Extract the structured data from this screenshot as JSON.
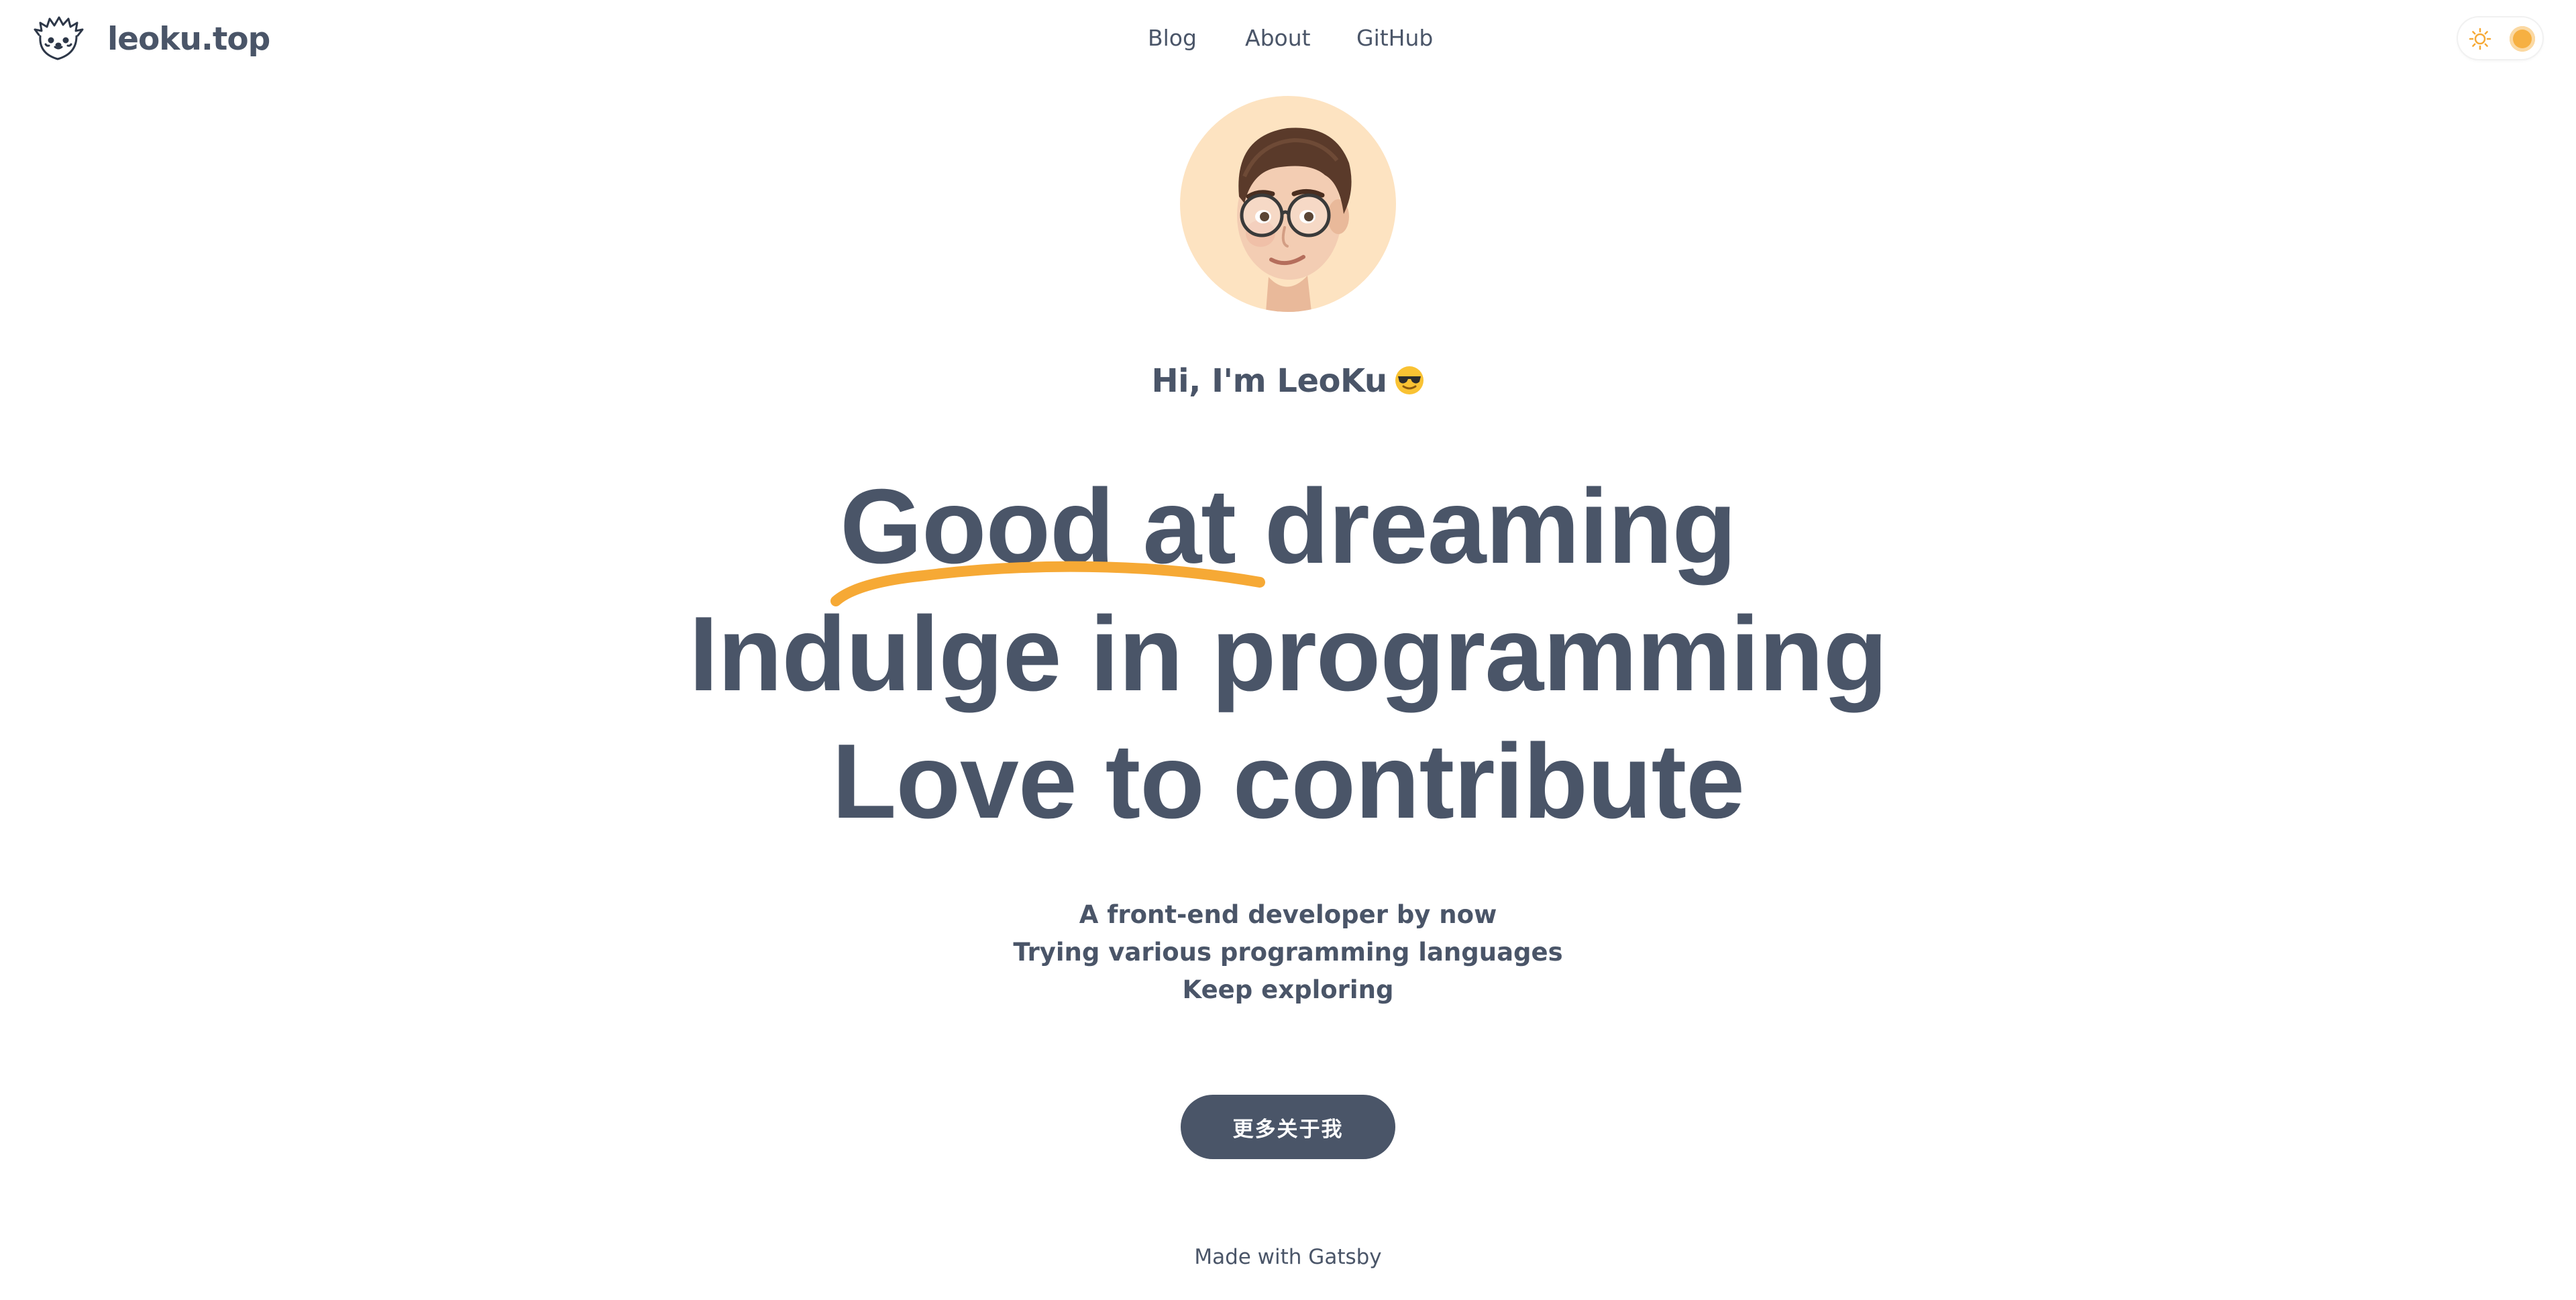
{
  "header": {
    "brand": {
      "logo_icon": "hedgehog-logo-icon",
      "name": "leoku.top"
    },
    "nav": [
      {
        "label": "Blog"
      },
      {
        "label": "About"
      },
      {
        "label": "GitHub"
      }
    ],
    "theme_toggle": {
      "icon": "sun-icon",
      "knob_color": "#f6b042"
    }
  },
  "hero": {
    "avatar_icon": "memoji-avatar-icon",
    "greeting": "Hi, I'm LeoKu",
    "greeting_emoji": "sunglasses-emoji-icon",
    "headline": [
      "Good at dreaming",
      "Indulge in programming",
      "Love to contribute"
    ],
    "highlight_color": "#f6a935",
    "subtext": [
      "A front-end developer by now",
      "Trying various programming languages",
      "Keep exploring"
    ],
    "cta_label": "更多关于我"
  },
  "footer": {
    "text": "Made with Gatsby"
  },
  "colors": {
    "text": "#4a5568",
    "button_bg": "#4a5568",
    "avatar_bg": "#fde3c1",
    "accent": "#f6a935"
  }
}
